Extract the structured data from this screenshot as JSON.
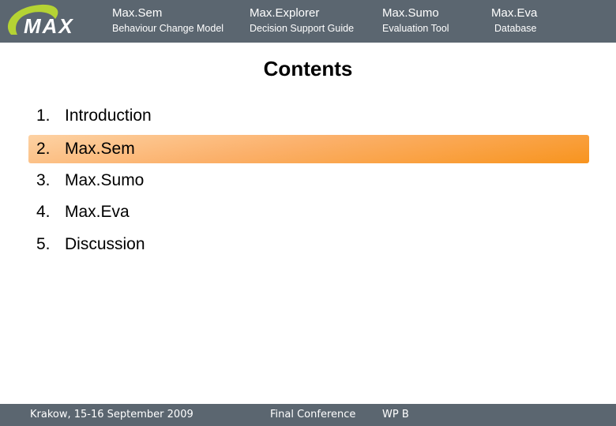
{
  "header": {
    "logo_text": "MAX",
    "nav": [
      {
        "title": "Max.Sem",
        "subtitle": "Behaviour Change Model"
      },
      {
        "title": "Max.Explorer",
        "subtitle": "Decision Support Guide"
      },
      {
        "title": "Max.Sumo",
        "subtitle": "Evaluation Tool"
      },
      {
        "title": "Max.Eva",
        "subtitle": "Database"
      }
    ]
  },
  "slide": {
    "title": "Contents",
    "items": [
      {
        "number": "1.",
        "label": "Introduction",
        "active": false
      },
      {
        "number": "2.",
        "label": "Max.Sem",
        "active": true
      },
      {
        "number": "3.",
        "label": "Max.Sumo",
        "active": false
      },
      {
        "number": "4.",
        "label": "Max.Eva",
        "active": false
      },
      {
        "number": "5.",
        "label": "Discussion",
        "active": false
      }
    ]
  },
  "footer": {
    "location_date": "Krakow, 15-16 September 2009",
    "event": "Final Conference",
    "work_package": "WP B"
  },
  "colors": {
    "header_bg": "#5b6670",
    "logo_green": "#b5d334",
    "highlight_orange": "#f8941e"
  }
}
